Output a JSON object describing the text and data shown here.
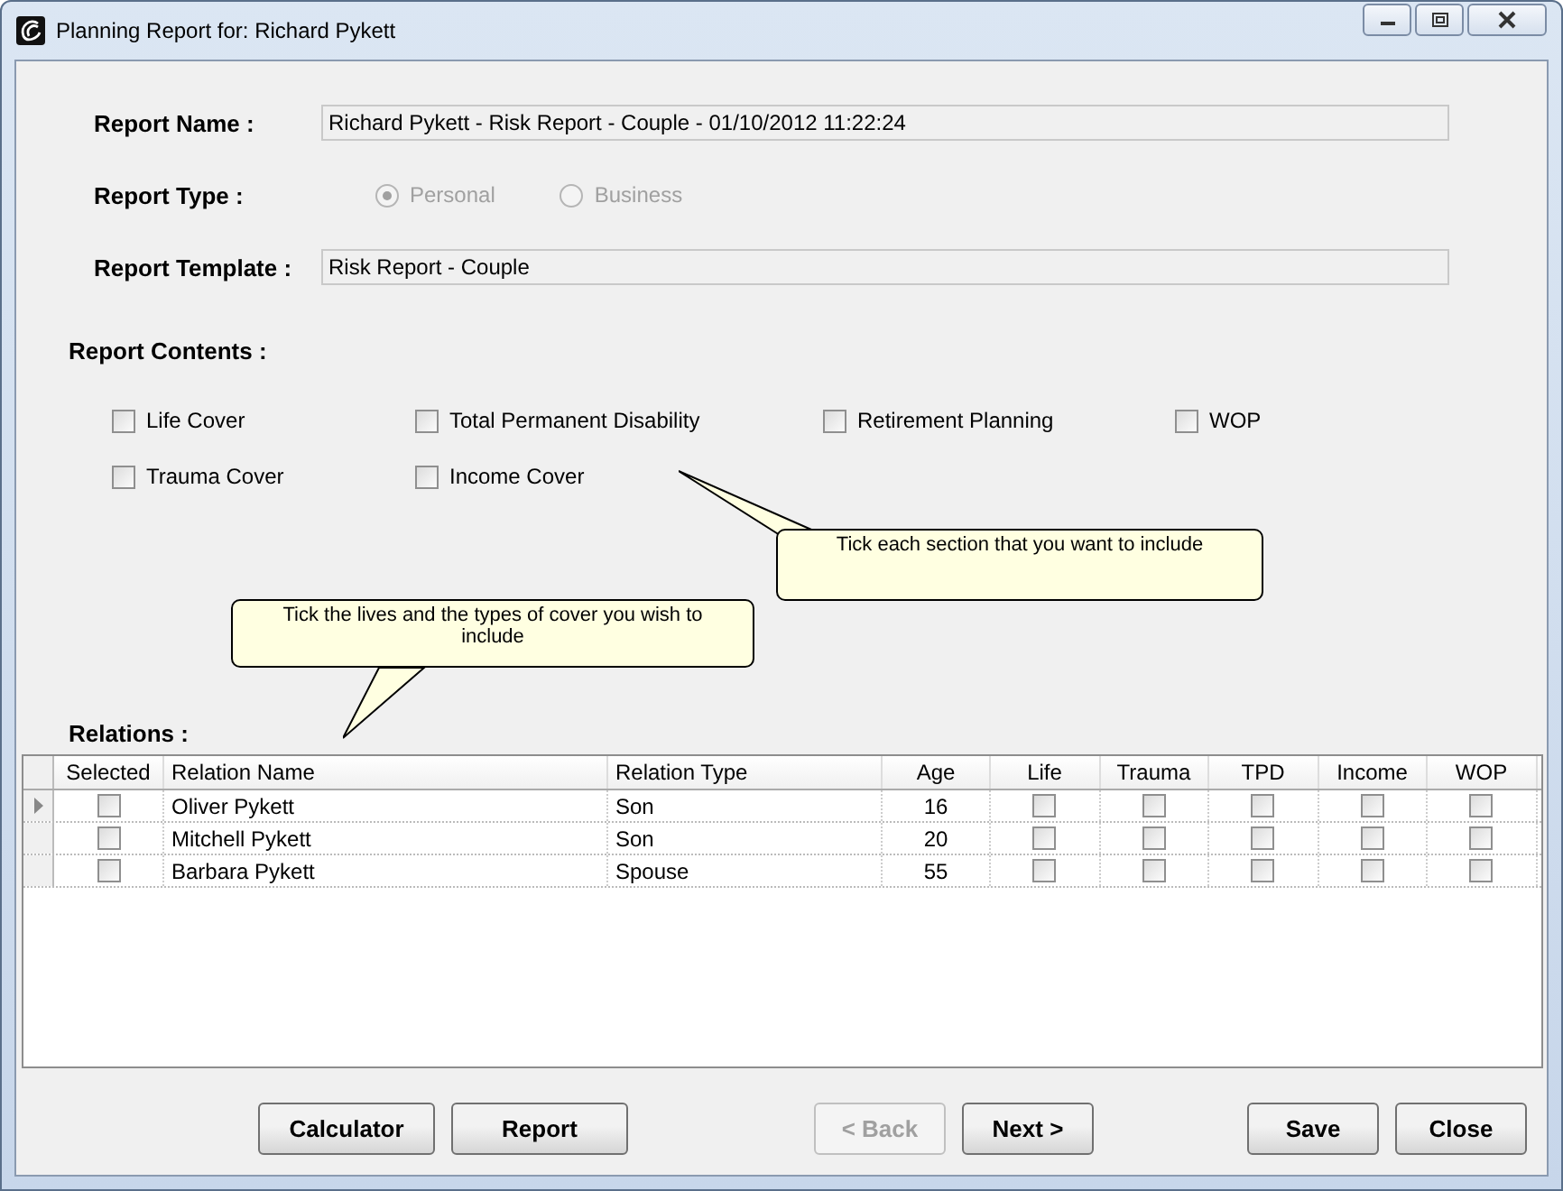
{
  "window": {
    "title": "Planning Report for: Richard Pykett"
  },
  "report_name": {
    "label": "Report Name :",
    "value": "Richard Pykett - Risk Report - Couple - 01/10/2012 11:22:24"
  },
  "report_type": {
    "label": "Report Type :",
    "options": [
      {
        "label": "Personal",
        "selected": true,
        "disabled": true
      },
      {
        "label": "Business",
        "selected": false,
        "disabled": true
      }
    ]
  },
  "report_template": {
    "label": "Report Template :",
    "value": "Risk Report - Couple"
  },
  "report_contents": {
    "label": "Report Contents :",
    "items": [
      {
        "label": "Life Cover",
        "checked": false
      },
      {
        "label": "Total Permanent Disability",
        "checked": false
      },
      {
        "label": "Retirement Planning",
        "checked": false
      },
      {
        "label": "WOP",
        "checked": false
      },
      {
        "label": "Trauma Cover",
        "checked": false
      },
      {
        "label": "Income Cover",
        "checked": false
      }
    ]
  },
  "tooltips": [
    "Tick each section that you want to include",
    "Tick the lives and the types of cover you wish to include"
  ],
  "relations": {
    "label": "Relations :",
    "columns": [
      "Selected",
      "Relation Name",
      "Relation Type",
      "Age",
      "Life",
      "Trauma",
      "TPD",
      "Income",
      "WOP"
    ],
    "rows": [
      {
        "current": true,
        "selected": false,
        "name": "Oliver Pykett",
        "type": "Son",
        "age": "16",
        "life": false,
        "trauma": false,
        "tpd": false,
        "income": false,
        "wop": false
      },
      {
        "current": false,
        "selected": false,
        "name": "Mitchell Pykett",
        "type": "Son",
        "age": "20",
        "life": false,
        "trauma": false,
        "tpd": false,
        "income": false,
        "wop": false
      },
      {
        "current": false,
        "selected": false,
        "name": "Barbara Pykett",
        "type": "Spouse",
        "age": "55",
        "life": false,
        "trauma": false,
        "tpd": false,
        "income": false,
        "wop": false
      }
    ]
  },
  "buttons": [
    {
      "label": "Calculator",
      "disabled": false
    },
    {
      "label": "Report",
      "disabled": false
    },
    {
      "label": "< Back",
      "disabled": true
    },
    {
      "label": "Next >",
      "disabled": false
    },
    {
      "label": "Save",
      "disabled": false
    },
    {
      "label": "Close",
      "disabled": false
    }
  ]
}
